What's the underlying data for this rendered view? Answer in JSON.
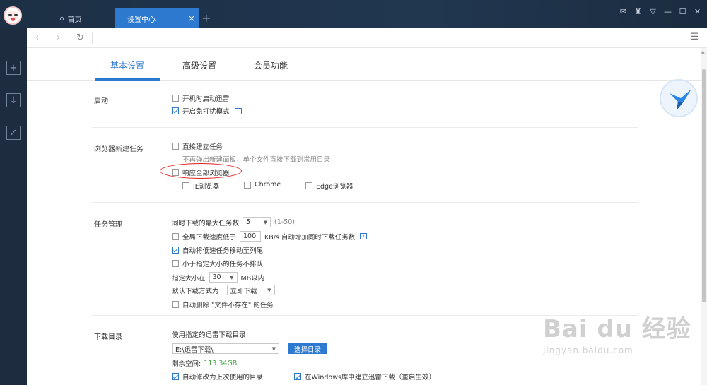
{
  "titlebar": {
    "tabs": [
      {
        "label": "首页"
      },
      {
        "label": "设置中心"
      }
    ],
    "close_glyph": "×",
    "add_glyph": "+"
  },
  "settings_tabs": [
    "基本设置",
    "高级设置",
    "会员功能"
  ],
  "sections": {
    "startup": {
      "title": "启动",
      "options": [
        {
          "label": "开机时启动迅雷",
          "checked": false
        },
        {
          "label": "开启免打扰模式",
          "checked": true
        }
      ]
    },
    "browser": {
      "title": "浏览器新建任务",
      "direct_label": "直接建立任务",
      "direct_hint": "不再弹出新建面板，单个文件直接下载到常用目录",
      "respond_all_label": "响应全部浏览器",
      "browsers": [
        "IE浏览器",
        "Chrome",
        "Edge浏览器"
      ]
    },
    "task": {
      "title": "任务管理",
      "max_tasks_label": "同时下载的最大任务数",
      "max_tasks_value": "5",
      "max_tasks_range": "(1-50)",
      "speed_prefix": "全局下载速度低于",
      "speed_value": "100",
      "speed_suffix": "KB/s 自动增加同时下载任务数",
      "auto_move_label": "自动将低速任务移动至列尾",
      "small_label": "小于指定大小的任务不排队",
      "size_prefix": "指定大小在",
      "size_value": "30",
      "size_suffix": "MB以内",
      "default_mode_label": "默认下载方式为",
      "default_mode_value": "立即下载",
      "auto_delete_label": "自动删除 \"文件不存在\" 的任务"
    },
    "dir": {
      "title": "下载目录",
      "use_label": "使用指定的迅雷下载目录",
      "path": "E:\\迅雷下载\\",
      "choose_button": "选择目录",
      "free_label": "剩余空间:",
      "free_value": "113.34GB",
      "auto_change_label": "自动修改为上次使用的目录",
      "windows_lib_label": "在Windows库中建立迅雷下载（重启生效）"
    }
  },
  "watermark": {
    "main": "Bai du 经验",
    "sub": "jingyan.baidu.com"
  },
  "colors": {
    "accent": "#2c79cf",
    "titlebar": "#1c2f45",
    "highlight_oval": "#e02020",
    "free_space": "#3fa63f"
  }
}
